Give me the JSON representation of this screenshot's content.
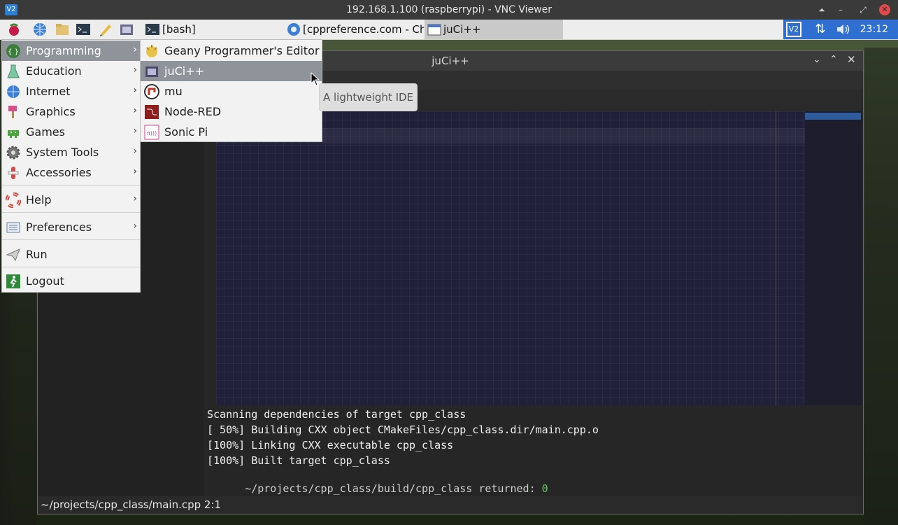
{
  "vnc": {
    "title": "192.168.1.100 (raspberrypi) - VNC Viewer",
    "logo": "V2"
  },
  "taskbar": {
    "tasks": [
      {
        "label": "[bash]",
        "icon": "terminal-icon"
      },
      {
        "label": "[cppreference.com - Ch...",
        "icon": "chromium-icon"
      },
      {
        "label": "juCi++",
        "icon": "window-icon"
      }
    ],
    "clock": "23:12",
    "tray_logo": "V2"
  },
  "main_menu": {
    "items": [
      {
        "label": "Programming",
        "icon": "programming-icon",
        "submenu": true
      },
      {
        "label": "Education",
        "icon": "education-icon",
        "submenu": true
      },
      {
        "label": "Internet",
        "icon": "globe-icon",
        "submenu": true
      },
      {
        "label": "Graphics",
        "icon": "paintbrush-icon",
        "submenu": true
      },
      {
        "label": "Games",
        "icon": "games-icon",
        "submenu": true
      },
      {
        "label": "System Tools",
        "icon": "gear-icon",
        "submenu": true
      },
      {
        "label": "Accessories",
        "icon": "accessories-icon",
        "submenu": true
      },
      {
        "label": "Help",
        "icon": "lifebuoy-icon",
        "submenu": true
      },
      {
        "label": "Preferences",
        "icon": "preferences-icon",
        "submenu": true
      },
      {
        "label": "Run",
        "icon": "paper-plane-icon",
        "submenu": false
      },
      {
        "label": "Logout",
        "icon": "exit-icon",
        "submenu": false
      }
    ]
  },
  "programming_menu": {
    "items": [
      {
        "label": "Geany Programmer's Editor",
        "icon": "geany-icon"
      },
      {
        "label": "juCi++",
        "icon": "jucipp-icon"
      },
      {
        "label": "mu",
        "icon": "mu-icon"
      },
      {
        "label": "Node-RED",
        "icon": "node-red-icon"
      },
      {
        "label": "Sonic Pi",
        "icon": "sonic-pi-icon"
      }
    ]
  },
  "tooltip": {
    "text": "A lightweight IDE"
  },
  "juci": {
    "title": "juCi++",
    "terminal": {
      "lines": [
        "Scanning dependencies of target cpp_class",
        "[ 50%] Building CXX object CMakeFiles/cpp_class.dir/main.cpp.o",
        "[100%] Linking CXX executable cpp_class",
        "[100%] Built target cpp_class"
      ],
      "result_prefix": "~/projects/cpp_class/build/cpp_class returned: ",
      "result_code": "0",
      "result_code_color": "#5ac85a"
    },
    "status": "~/projects/cpp_class/main.cpp 2:1"
  },
  "colors": {
    "menu_highlight": "#8e949a",
    "tray_blue": "#2e6fd1"
  }
}
